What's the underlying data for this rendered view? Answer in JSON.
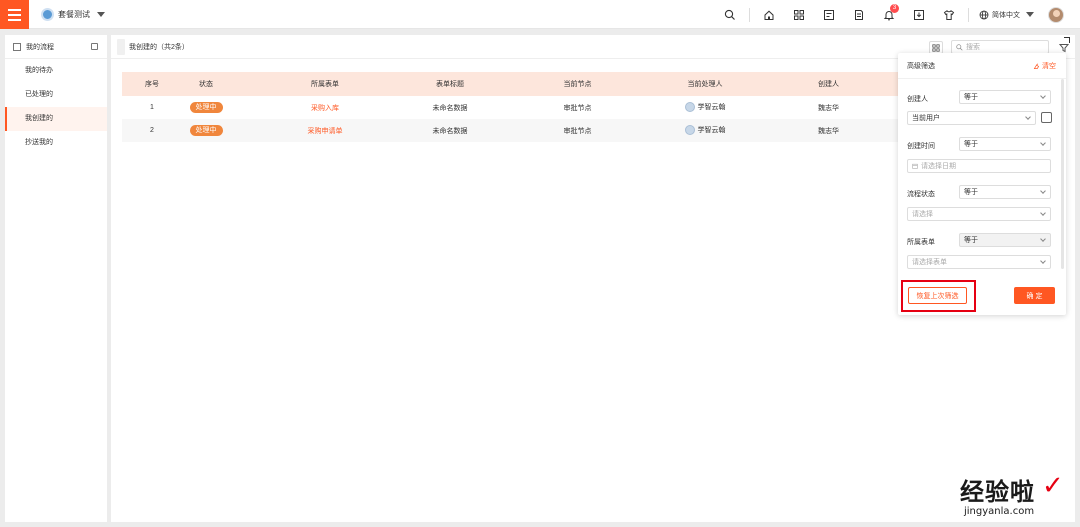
{
  "topbar": {
    "app_name": "套餐测试",
    "notification_count": "3",
    "language": "简体中文",
    "icons": [
      "search-icon",
      "home-icon",
      "apps-icon",
      "tasks-icon",
      "document-icon",
      "bell-icon",
      "download-icon",
      "shirt-icon",
      "globe-icon"
    ]
  },
  "sidebar": {
    "title": "我的流程",
    "items": [
      {
        "label": "我的待办"
      },
      {
        "label": "已处理的"
      },
      {
        "label": "我创建的",
        "active": true
      },
      {
        "label": "抄送我的"
      }
    ]
  },
  "main": {
    "title": "我创建的（共2条）",
    "search_placeholder": "搜索",
    "columns": [
      "序号",
      "状态",
      "所属表单",
      "表单标题",
      "当前节点",
      "当前处理人",
      "创建人"
    ],
    "rows": [
      {
        "index": "1",
        "status": "处理中",
        "form": "采购入库",
        "title": "未命名数据",
        "node": "审批节点",
        "handler": "学智云翰",
        "creator": "魏志华"
      },
      {
        "index": "2",
        "status": "处理中",
        "form": "采购申请单",
        "title": "未命名数据",
        "node": "审批节点",
        "handler": "学智云翰",
        "creator": "魏志华"
      }
    ]
  },
  "filter": {
    "title": "高级筛选",
    "clear_label": "清空",
    "fields": [
      {
        "label": "创建人",
        "operator": "等于",
        "value": "当前用户"
      },
      {
        "label": "创建时间",
        "operator": "等于",
        "value_placeholder": "请选择日期"
      },
      {
        "label": "流程状态",
        "operator": "等于",
        "value_placeholder": "请选择"
      },
      {
        "label": "所属表单",
        "operator": "等于",
        "value_placeholder": "请选择表单"
      }
    ],
    "restore_label": "恢复上次筛选",
    "confirm_label": "确 定"
  },
  "watermark": {
    "text": "经验啦",
    "url": "jingyanla.com"
  },
  "colors": {
    "accent": "#ff5722",
    "status_badge": "#f0863c",
    "header_row": "#fde6dc",
    "highlight_box": "#e60012"
  }
}
